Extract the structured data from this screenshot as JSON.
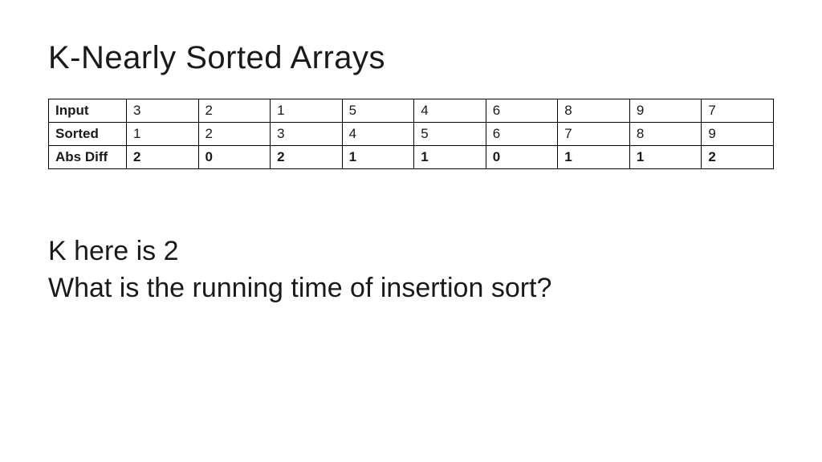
{
  "title": "K-Nearly Sorted Arrays",
  "table": {
    "rows": [
      {
        "header": "Input",
        "values": [
          "3",
          "2",
          "1",
          "5",
          "4",
          "6",
          "8",
          "9",
          "7"
        ],
        "bold": false
      },
      {
        "header": "Sorted",
        "values": [
          "1",
          "2",
          "3",
          "4",
          "5",
          "6",
          "7",
          "8",
          "9"
        ],
        "bold": false
      },
      {
        "header": "Abs Diff",
        "values": [
          "2",
          "0",
          "2",
          "1",
          "1",
          "0",
          "1",
          "1",
          "2"
        ],
        "bold": true
      }
    ]
  },
  "body": {
    "line1": "K here is 2",
    "line2": "What is the running time of insertion sort?"
  },
  "chart_data": {
    "type": "table",
    "title": "K-Nearly Sorted Arrays",
    "columns": [
      "Input",
      "Sorted",
      "Abs Diff"
    ],
    "series": [
      {
        "name": "Input",
        "values": [
          3,
          2,
          1,
          5,
          4,
          6,
          8,
          9,
          7
        ]
      },
      {
        "name": "Sorted",
        "values": [
          1,
          2,
          3,
          4,
          5,
          6,
          7,
          8,
          9
        ]
      },
      {
        "name": "Abs Diff",
        "values": [
          2,
          0,
          2,
          1,
          1,
          0,
          1,
          1,
          2
        ]
      }
    ],
    "k": 2
  }
}
